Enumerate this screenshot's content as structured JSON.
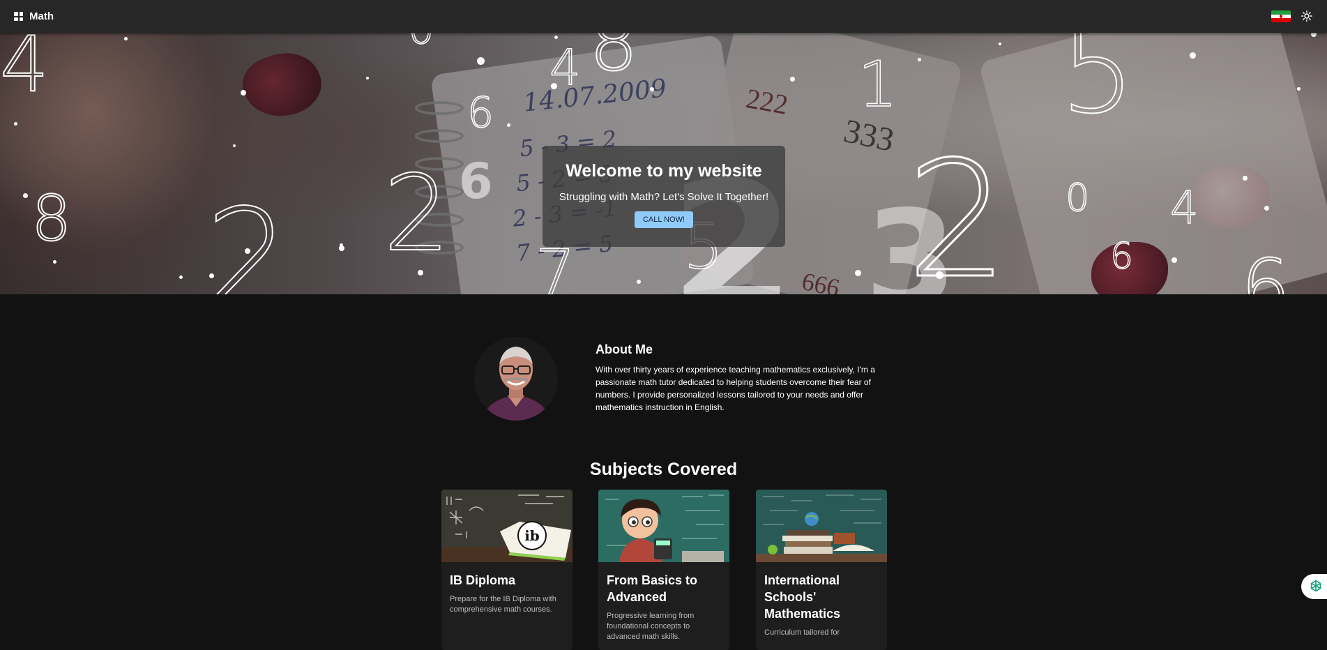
{
  "app": {
    "title": "Math",
    "icons": {
      "brand": "grid-icon",
      "language_flag": "iran-flag-icon",
      "theme_toggle": "sun-icon",
      "chat": "openai-chat-icon"
    }
  },
  "hero": {
    "title": "Welcome to my website",
    "subtitle": "Struggling with Math? Let's Solve It Together!",
    "cta_label": "CALL NOW!"
  },
  "about": {
    "title": "About Me",
    "text": "With over thirty years of experience teaching mathematics exclusively, I'm a passionate math tutor dedicated to helping students overcome their fear of numbers. I provide personalized lessons tailored to your needs and offer mathematics instruction in English."
  },
  "subjects": {
    "title": "Subjects Covered",
    "items": [
      {
        "title": "IB Diploma",
        "description": "Prepare for the IB Diploma with comprehensive math courses."
      },
      {
        "title": "From Basics to Advanced",
        "description": "Progressive learning from foundational concepts to advanced math skills."
      },
      {
        "title": "International Schools' Mathematics",
        "description": "Curriculum tailored for"
      }
    ]
  },
  "colors": {
    "topbar": "#272727",
    "background": "#121212",
    "card": "#1e1e1e",
    "cta": "#90caf9"
  }
}
